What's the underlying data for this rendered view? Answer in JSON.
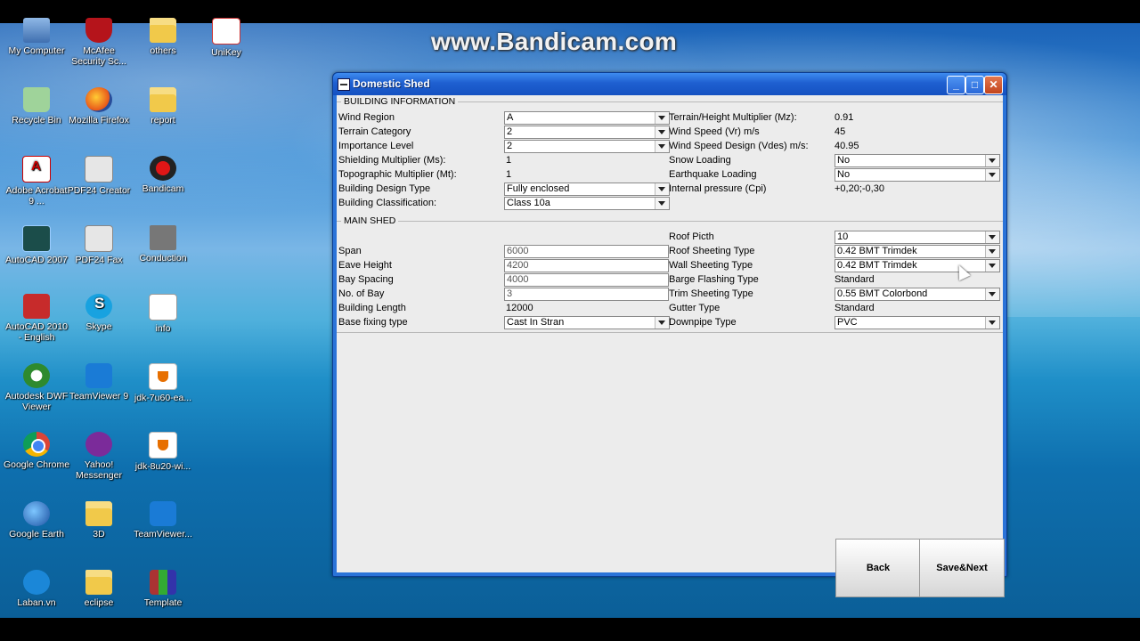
{
  "watermark": "www.Bandicam.com",
  "desktop_icons": [
    {
      "label": "My Computer",
      "icon": "computer-icon"
    },
    {
      "label": "McAfee Security Sc...",
      "icon": "mcafee-shield-icon"
    },
    {
      "label": "others",
      "icon": "folder-icon"
    },
    {
      "label": "UniKey",
      "icon": "unikey-icon"
    },
    {
      "label": "Recycle Bin",
      "icon": "recycle-bin-icon"
    },
    {
      "label": "Mozilla Firefox",
      "icon": "firefox-icon"
    },
    {
      "label": "report",
      "icon": "folder-icon"
    },
    {
      "label": "Adobe Acrobat 9 ...",
      "icon": "acrobat-icon"
    },
    {
      "label": "PDF24 Creator",
      "icon": "pdf24-icon"
    },
    {
      "label": "Bandicam",
      "icon": "bandicam-icon"
    },
    {
      "label": "AutoCAD 2007",
      "icon": "autocad-icon"
    },
    {
      "label": "PDF24 Fax",
      "icon": "pdf24-fax-icon"
    },
    {
      "label": "Conduction",
      "icon": "conduction-icon"
    },
    {
      "label": "AutoCAD 2010 - English",
      "icon": "autocad2010-icon"
    },
    {
      "label": "Skype",
      "icon": "skype-icon"
    },
    {
      "label": "info",
      "icon": "text-document-icon"
    },
    {
      "label": "Autodesk DWF Viewer",
      "icon": "dwf-viewer-icon"
    },
    {
      "label": "TeamViewer 9",
      "icon": "teamviewer-icon"
    },
    {
      "label": "jdk-7u60-ea...",
      "icon": "java-icon"
    },
    {
      "label": "Google Chrome",
      "icon": "chrome-icon"
    },
    {
      "label": "Yahoo! Messenger",
      "icon": "yahoo-messenger-icon"
    },
    {
      "label": "jdk-8u20-wi...",
      "icon": "java-icon"
    },
    {
      "label": "Google Earth",
      "icon": "google-earth-icon"
    },
    {
      "label": "3D",
      "icon": "folder-icon"
    },
    {
      "label": "TeamViewer...",
      "icon": "teamviewer-icon"
    },
    {
      "label": "Laban.vn",
      "icon": "laban-icon"
    },
    {
      "label": "eclipse",
      "icon": "folder-icon"
    },
    {
      "label": "Template",
      "icon": "winrar-icon"
    }
  ],
  "window": {
    "title": "Domestic Shed",
    "building_info": {
      "section_title": "BUILDING INFORMATION",
      "wind_region_label": "Wind Region",
      "wind_region_value": "A",
      "terrain_category_label": "Terrain Category",
      "terrain_category_value": "2",
      "importance_level_label": "Importance Level",
      "importance_level_value": "2",
      "shielding_label": "Shielding Multiplier (Ms):",
      "shielding_value": "1",
      "topographic_label": "Topographic Multiplier (Mt):",
      "topographic_value": "1",
      "design_type_label": "Building Design Type",
      "design_type_value": "Fully enclosed",
      "classification_label": "Building Classification:",
      "classification_value": "Class 10a",
      "terrain_height_label": "Terrain/Height Multiplier (Mz):",
      "terrain_height_value": "0.91",
      "wind_speed_label": "Wind Speed (Vr) m/s",
      "wind_speed_value": "45",
      "wind_speed_design_label": "Wind Speed Design (Vdes) m/s:",
      "wind_speed_design_value": "40.95",
      "snow_loading_label": "Snow Loading",
      "snow_loading_value": "No",
      "earthquake_label": "Earthquake Loading",
      "earthquake_value": "No",
      "internal_pressure_label": "Internal pressure (Cpi)",
      "internal_pressure_value": "+0,20;-0,30"
    },
    "main_shed": {
      "section_title": "MAIN SHED",
      "span_label": "Span",
      "span_value": "6000",
      "eave_height_label": "Eave Height",
      "eave_height_value": "4200",
      "bay_spacing_label": "Bay Spacing",
      "bay_spacing_value": "4000",
      "no_of_bay_label": "No. of Bay",
      "no_of_bay_value": "3",
      "building_length_label": "Building Length",
      "building_length_value": "12000",
      "base_fixing_label": "Base fixing type",
      "base_fixing_value": "Cast In Stran",
      "roof_pitch_label": "Roof Picth",
      "roof_pitch_value": "10",
      "roof_sheeting_label": "Roof Sheeting Type",
      "roof_sheeting_value": "0.42 BMT Trimdek",
      "wall_sheeting_label": "Wall Sheeting Type",
      "wall_sheeting_value": "0.42 BMT Trimdek",
      "barge_flashing_label": "Barge Flashing Type",
      "barge_flashing_value": "Standard",
      "trim_sheeting_label": "Trim Sheeting Type",
      "trim_sheeting_value": "0.55 BMT Colorbond",
      "gutter_label": "Gutter Type",
      "gutter_value": "Standard",
      "downpipe_label": "Downpipe Type",
      "downpipe_value": "PVC"
    },
    "back_label": "Back",
    "save_next_label": "Save&Next"
  }
}
